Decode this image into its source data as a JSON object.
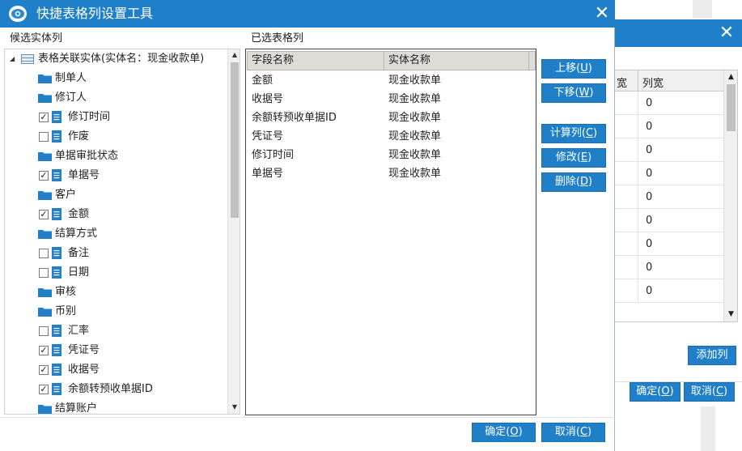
{
  "window": {
    "title": "快捷表格列设置工具",
    "close_glyph": "✕"
  },
  "left_panel": {
    "label": "候选实体列",
    "root": {
      "label": "表格关联实体(实体名：现金收款单)",
      "expander": "◢"
    },
    "nodes": [
      {
        "type": "folder",
        "label": "制单人"
      },
      {
        "type": "folder",
        "label": "修订人"
      },
      {
        "type": "field",
        "label": "修订时间",
        "checked": true
      },
      {
        "type": "field",
        "label": "作废",
        "checked": false
      },
      {
        "type": "folder",
        "label": "单据审批状态"
      },
      {
        "type": "field",
        "label": "单据号",
        "checked": true
      },
      {
        "type": "folder",
        "label": "客户"
      },
      {
        "type": "field",
        "label": "金额",
        "checked": true
      },
      {
        "type": "folder",
        "label": "结算方式"
      },
      {
        "type": "field",
        "label": "备注",
        "checked": false
      },
      {
        "type": "field",
        "label": "日期",
        "checked": false
      },
      {
        "type": "folder",
        "label": "审核"
      },
      {
        "type": "folder",
        "label": "币别"
      },
      {
        "type": "field",
        "label": "汇率",
        "checked": false
      },
      {
        "type": "field",
        "label": "凭证号",
        "checked": true
      },
      {
        "type": "field",
        "label": "收据号",
        "checked": true
      },
      {
        "type": "field",
        "label": "余额转预收单据ID",
        "checked": true
      },
      {
        "type": "folder",
        "label": "结算账户"
      }
    ],
    "check_glyph": "✓",
    "scroll_up": "▲",
    "scroll_down": "▼"
  },
  "right_panel": {
    "label": "已选表格列",
    "columns": [
      "字段名称",
      "实体名称"
    ],
    "rows": [
      {
        "field": "金额",
        "entity": "现金收款单"
      },
      {
        "field": "收据号",
        "entity": "现金收款单"
      },
      {
        "field": "余额转预收单据ID",
        "entity": "现金收款单"
      },
      {
        "field": "凭证号",
        "entity": "现金收款单"
      },
      {
        "field": "修订时间",
        "entity": "现金收款单"
      },
      {
        "field": "单据号",
        "entity": "现金收款单"
      }
    ]
  },
  "actions": {
    "move_up": {
      "text": "上移(",
      "key": "U",
      "tail": ")"
    },
    "move_down": {
      "text": "下移(",
      "key": "W",
      "tail": ")"
    },
    "calc_col": {
      "text": "计算列(",
      "key": "C",
      "tail": ")"
    },
    "edit": {
      "text": "修改(",
      "key": "E",
      "tail": ")"
    },
    "delete": {
      "text": "删除(",
      "key": "D",
      "tail": ")"
    }
  },
  "footer": {
    "ok": {
      "text": "确定(",
      "key": "O",
      "tail": ")"
    },
    "cancel": {
      "text": "取消(",
      "key": "C",
      "tail": ")"
    }
  },
  "background_dialog": {
    "close_glyph": "✕",
    "header_prev": "宽",
    "header_col": "列宽",
    "values": [
      "0",
      "0",
      "0",
      "0",
      "0",
      "0",
      "0",
      "0",
      "0"
    ],
    "add_column": "添加列",
    "ok": {
      "text": "确定(",
      "key": "O",
      "tail": ")"
    },
    "cancel": {
      "text": "取消(",
      "key": "C",
      "tail": ")"
    },
    "scroll_up": "▲",
    "scroll_down": "▼"
  },
  "colors": {
    "accent": "#1f7fc8",
    "folder": "#1f7fc8",
    "document": "#1f7fc8"
  },
  "icons": {
    "app": "eye-logo-icon",
    "folder": "folder-icon",
    "document": "document-icon",
    "table": "table-icon"
  }
}
